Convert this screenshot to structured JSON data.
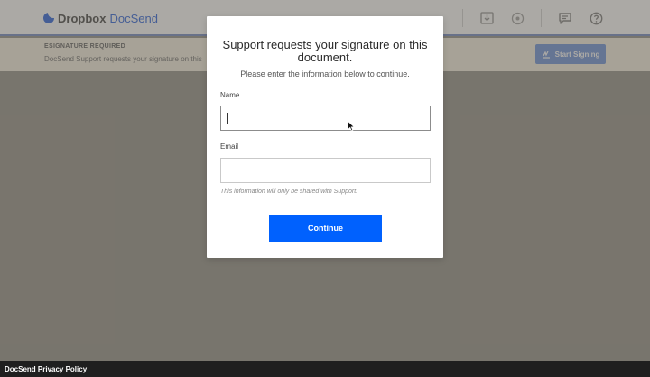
{
  "header": {
    "brand_primary": "Dropbox",
    "brand_secondary": "DocSend",
    "icons": [
      "download-icon",
      "present-icon",
      "chat-icon",
      "help-icon"
    ]
  },
  "notice": {
    "title": "ESIGNATURE REQUIRED",
    "text": "DocSend Support requests your signature on this",
    "button_label": "Start Signing"
  },
  "modal": {
    "title": "Support requests your signature on this document.",
    "subtitle": "Please enter the information below to continue.",
    "name_label": "Name",
    "name_value": "",
    "email_label": "Email",
    "email_value": "",
    "disclaimer": "This information will only be shared with Support.",
    "continue_label": "Continue"
  },
  "footer": {
    "privacy_label": "DocSend Privacy Policy"
  },
  "colors": {
    "accent": "#0061fe",
    "footer_bg": "#1f1f1f",
    "notice_bg": "#f7f1e4"
  }
}
